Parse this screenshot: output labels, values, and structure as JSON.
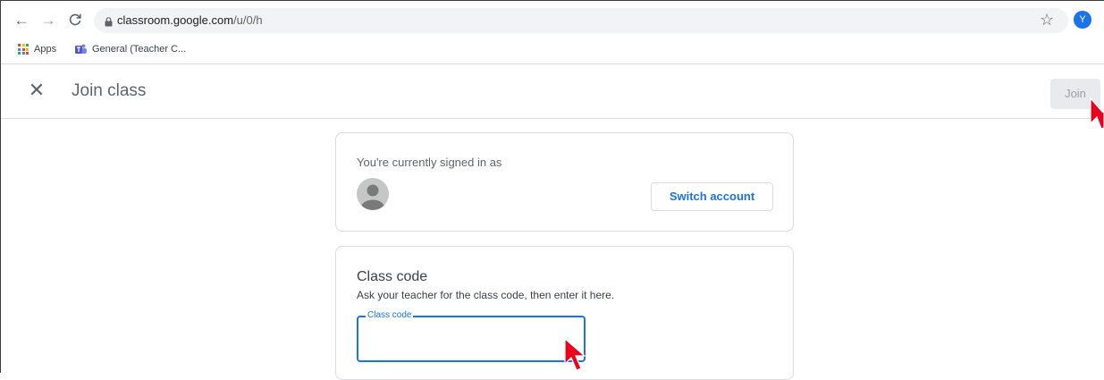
{
  "browser": {
    "url_host": "classroom.google.com",
    "url_path": "/u/0/h",
    "profile_initial": "Y",
    "bookmarks": [
      {
        "label": "Apps",
        "icon": "apps-grid-icon"
      },
      {
        "label": "General (Teacher C...",
        "icon": "teams-icon"
      }
    ]
  },
  "header": {
    "title": "Join class",
    "join_label": "Join"
  },
  "account_card": {
    "label": "You're currently signed in as",
    "switch_label": "Switch account"
  },
  "class_code_card": {
    "heading": "Class code",
    "subtext": "Ask your teacher for the class code, then enter it here.",
    "field_label": "Class code",
    "field_value": ""
  },
  "colors": {
    "accent": "#1a73e8",
    "cursor": "#e8001c"
  }
}
